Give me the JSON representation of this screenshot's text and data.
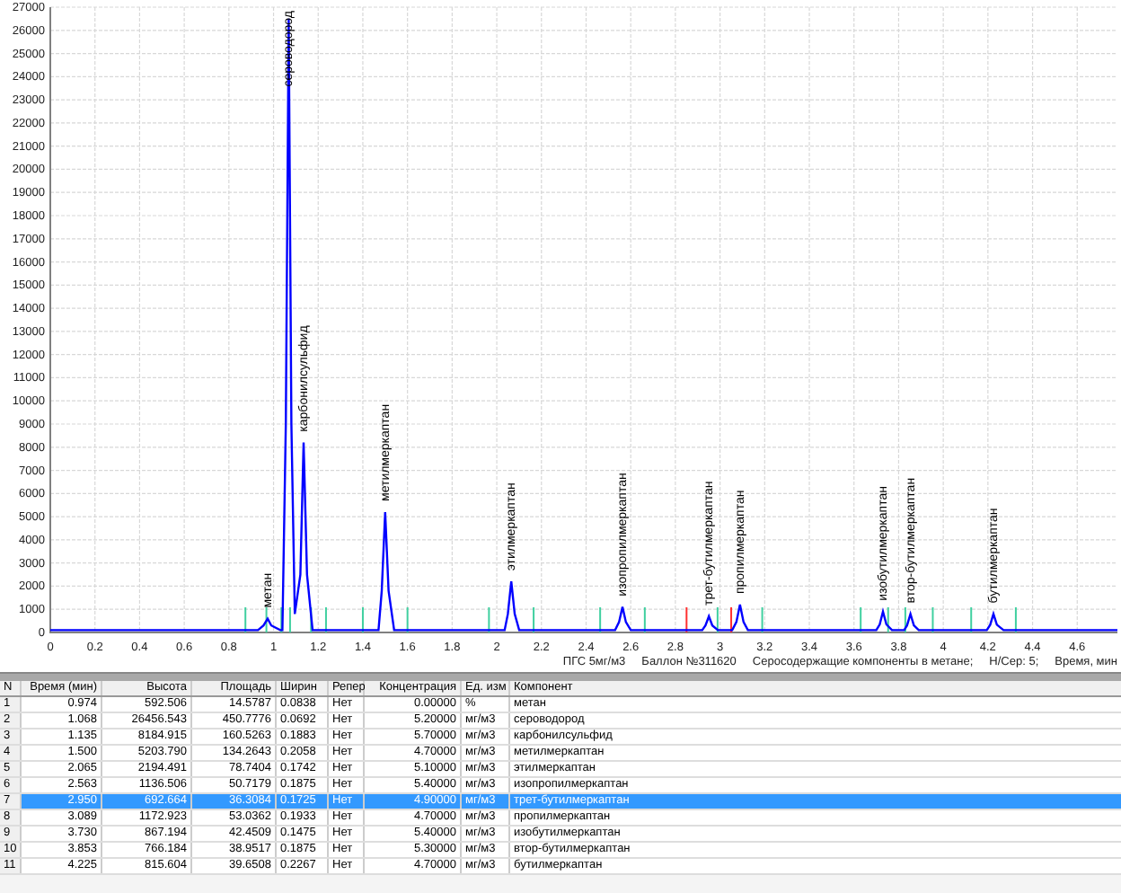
{
  "chart": {
    "chart_data": {
      "type": "line",
      "xlabel": "Время, мин",
      "xlim": [
        0,
        4.78
      ],
      "ylim": [
        0,
        27000
      ],
      "xticks": [
        0,
        0.2,
        0.4,
        0.6,
        0.8,
        1,
        1.2,
        1.4,
        1.6,
        1.8,
        2,
        2.2,
        2.4,
        2.6,
        2.8,
        3,
        3.2,
        3.4,
        3.6,
        3.8,
        4,
        4.2,
        4.4,
        4.6
      ],
      "yticks": [
        0,
        1000,
        2000,
        3000,
        4000,
        5000,
        6000,
        7000,
        8000,
        9000,
        10000,
        11000,
        12000,
        13000,
        14000,
        15000,
        16000,
        17000,
        18000,
        19000,
        20000,
        21000,
        22000,
        23000,
        24000,
        25000,
        26000,
        27000
      ],
      "x": [
        0,
        0.93,
        0.955,
        0.974,
        0.99,
        1.03,
        1.04,
        1.055,
        1.068,
        1.08,
        1.095,
        1.12,
        1.135,
        1.15,
        1.175,
        1.47,
        1.485,
        1.5,
        1.515,
        1.54,
        2.035,
        2.05,
        2.065,
        2.08,
        2.1,
        2.53,
        2.548,
        2.563,
        2.578,
        2.6,
        2.92,
        2.935,
        2.95,
        2.965,
        2.99,
        3.055,
        3.073,
        3.089,
        3.105,
        3.125,
        3.7,
        3.715,
        3.73,
        3.745,
        3.77,
        3.825,
        3.838,
        3.853,
        3.868,
        3.89,
        4.195,
        4.21,
        4.225,
        4.24,
        4.27,
        4.78
      ],
      "grid": true,
      "series": [
        {
          "color": "#0000ff",
          "values": [
            100,
            100,
            300,
            600,
            300,
            100,
            100,
            9000,
            26500,
            9000,
            800,
            2500,
            8200,
            2500,
            100,
            100,
            1800,
            5200,
            1800,
            100,
            100,
            800,
            2200,
            800,
            100,
            100,
            450,
            1100,
            450,
            100,
            100,
            300,
            700,
            300,
            100,
            100,
            450,
            1200,
            450,
            100,
            100,
            350,
            900,
            350,
            100,
            100,
            300,
            800,
            300,
            100,
            100,
            330,
            800,
            330,
            100,
            100
          ]
        }
      ],
      "annotations": [
        "метан",
        "сероводород",
        "карбонилсульфид",
        "метилмеркаптан",
        "этилмеркаптан",
        "изопропилмеркаптан",
        "трет-бутилмеркаптан",
        "пропилмеркаптан",
        "изобутилмеркаптан",
        "втор-бутилмеркаптан",
        "бутилмеркаптан"
      ]
    },
    "caption": [
      "ПГС 5мг/м3",
      "Баллон №311620",
      "Серосодержащие компоненты в метане;",
      "H/Сер: 5;"
    ]
  },
  "table": {
    "columns": [
      "N",
      "Время (мин)",
      "Высота",
      "Площадь",
      "Ширин",
      "Репер",
      "Концентрация",
      "Ед. изм",
      "Компонент"
    ],
    "rows": [
      {
        "cells": [
          "1",
          "0.974",
          "592.506",
          "14.5787",
          "0.0838",
          "Нет",
          "0.00000",
          "%",
          "метан"
        ],
        "selected": false
      },
      {
        "cells": [
          "2",
          "1.068",
          "26456.543",
          "450.7776",
          "0.0692",
          "Нет",
          "5.20000",
          "мг/м3",
          "сероводород"
        ],
        "selected": false
      },
      {
        "cells": [
          "3",
          "1.135",
          "8184.915",
          "160.5263",
          "0.1883",
          "Нет",
          "5.70000",
          "мг/м3",
          "карбонилсульфид"
        ],
        "selected": false
      },
      {
        "cells": [
          "4",
          "1.500",
          "5203.790",
          "134.2643",
          "0.2058",
          "Нет",
          "4.70000",
          "мг/м3",
          "метилмеркаптан"
        ],
        "selected": false
      },
      {
        "cells": [
          "5",
          "2.065",
          "2194.491",
          "78.7404",
          "0.1742",
          "Нет",
          "5.10000",
          "мг/м3",
          "этилмеркаптан"
        ],
        "selected": false
      },
      {
        "cells": [
          "6",
          "2.563",
          "1136.506",
          "50.7179",
          "0.1875",
          "Нет",
          "5.40000",
          "мг/м3",
          "изопропилмеркаптан"
        ],
        "selected": false
      },
      {
        "cells": [
          "7",
          "2.950",
          "692.664",
          "36.3084",
          "0.1725",
          "Нет",
          "4.90000",
          "мг/м3",
          "трет-бутилмеркаптан"
        ],
        "selected": true
      },
      {
        "cells": [
          "8",
          "3.089",
          "1172.923",
          "53.0362",
          "0.1933",
          "Нет",
          "4.70000",
          "мг/м3",
          "пропилмеркаптан"
        ],
        "selected": false
      },
      {
        "cells": [
          "9",
          "3.730",
          "867.194",
          "42.4509",
          "0.1475",
          "Нет",
          "5.40000",
          "мг/м3",
          "изобутилмеркаптан"
        ],
        "selected": false
      },
      {
        "cells": [
          "10",
          "3.853",
          "766.184",
          "38.9517",
          "0.1875",
          "Нет",
          "5.30000",
          "мг/м3",
          "втор-бутилмеркаптан"
        ],
        "selected": false
      },
      {
        "cells": [
          "11",
          "4.225",
          "815.604",
          "39.6508",
          "0.2267",
          "Нет",
          "4.70000",
          "мг/м3",
          "бутилмеркаптан"
        ],
        "selected": false
      }
    ]
  }
}
